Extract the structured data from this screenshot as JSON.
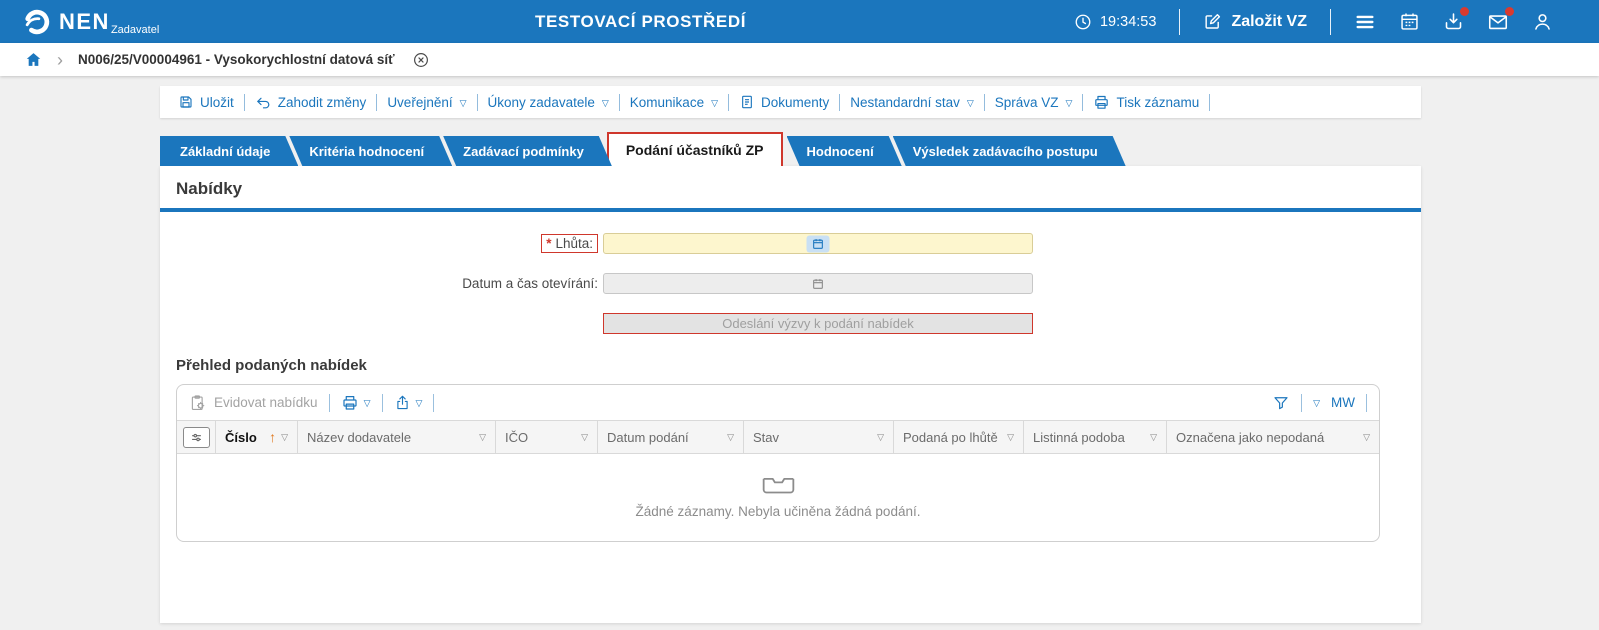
{
  "topbar": {
    "brand": "NEN",
    "brand_subtitle": "Zadavatel",
    "environment_title": "TESTOVACÍ PROSTŘEDÍ",
    "clock": "19:34:53",
    "create_vz_label": "Založit VZ"
  },
  "breadcrumb": {
    "current": "N006/25/V00004961 - Vysokorychlostní datová síť"
  },
  "toolbar": {
    "items": [
      {
        "label": "Uložit"
      },
      {
        "label": "Zahodit změny"
      },
      {
        "label": "Uveřejnění"
      },
      {
        "label": "Úkony zadavatele"
      },
      {
        "label": "Komunikace"
      },
      {
        "label": "Dokumenty"
      },
      {
        "label": "Nestandardní stav"
      },
      {
        "label": "Správa VZ"
      },
      {
        "label": "Tisk záznamu"
      }
    ]
  },
  "tabs": [
    {
      "label": "Základní údaje",
      "active": false
    },
    {
      "label": "Kritéria hodnocení",
      "active": false
    },
    {
      "label": "Zadávací podmínky",
      "active": false
    },
    {
      "label": "Podání účastníků ZP",
      "active": true
    },
    {
      "label": "Hodnocení",
      "active": false
    },
    {
      "label": "Výsledek zadávacího postupu",
      "active": false
    }
  ],
  "section": {
    "title": "Nabídky"
  },
  "form": {
    "required_marker": "*",
    "deadline_label": "Lhůta:",
    "deadline_value": "",
    "opening_label": "Datum a čas otevírání:",
    "opening_value": "",
    "send_invitation_label": "Odeslání výzvy k podání nabídek"
  },
  "offers": {
    "title": "Přehled podaných nabídek",
    "toolbar": {
      "register_label": "Evidovat nabídku",
      "mw_label": "MW"
    },
    "columns": [
      "Číslo",
      "Název dodavatele",
      "IČO",
      "Datum podání",
      "Stav",
      "Podaná po lhůtě",
      "Listinná podoba",
      "Označena jako nepodaná"
    ],
    "empty_message": "Žádné záznamy. Nebyla učiněna žádná podání."
  },
  "icons": {
    "dropdown": "▽",
    "sort_asc": "↑",
    "breadcrumb_chevron": "›"
  },
  "colors": {
    "header_blue": "#1b76bd",
    "alert_red": "#cf372c",
    "required_field_yellow": "#fdf6ce"
  }
}
